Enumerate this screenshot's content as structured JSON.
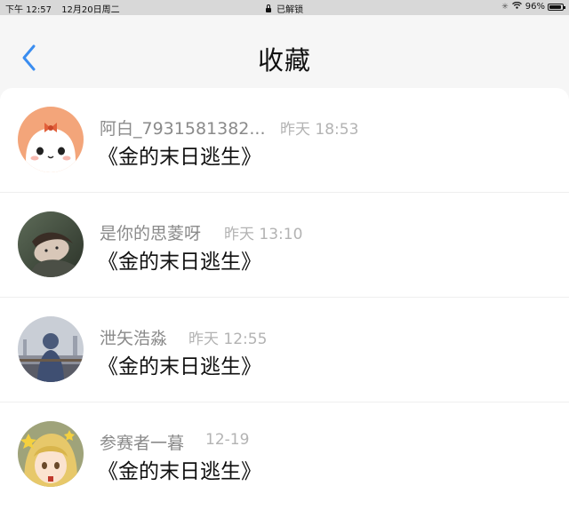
{
  "status_bar": {
    "time": "下午 12:57",
    "date": "12月20日周二",
    "lock_status": "已解锁",
    "battery": "96%",
    "battery_level": 0.96,
    "icons": [
      "lock-icon",
      "spinner-icon",
      "wifi-icon",
      "battery-icon"
    ]
  },
  "nav": {
    "title": "收藏",
    "back_icon": "chevron-left-icon",
    "accent": "#3a8df0"
  },
  "items": [
    {
      "user": "阿白_7931581382...",
      "time": "昨天 18:53",
      "title": "《金的末日逃生》",
      "avatar": "cartoon-bunny-avatar"
    },
    {
      "user": "是你的思菱呀",
      "time": "昨天 13:10",
      "title": "《金的末日逃生》",
      "avatar": "photo-avatar"
    },
    {
      "user": "泄矢浩淼",
      "time": "昨天 12:55",
      "title": "《金的末日逃生》",
      "avatar": "photo-avatar"
    },
    {
      "user": "参赛者一暮",
      "time": "12-19",
      "title": "《金的末日逃生》",
      "avatar": "anime-avatar"
    }
  ]
}
